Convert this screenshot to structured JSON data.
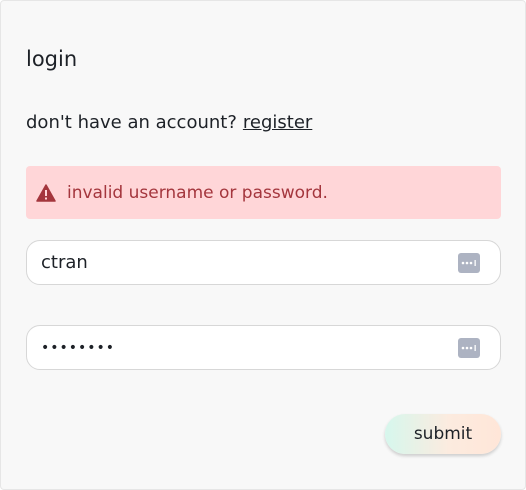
{
  "form": {
    "title": "login",
    "register_prompt": "don't have an account?",
    "register_link": "register"
  },
  "alert": {
    "message": "invalid username or password.",
    "icon": "warning-triangle-icon",
    "color": "#a4363d",
    "background": "#ffd6d8"
  },
  "fields": {
    "username": {
      "value": "ctran",
      "icon": "password-manager-icon"
    },
    "password": {
      "value": "••••••••",
      "icon": "password-manager-icon"
    }
  },
  "submit": {
    "label": "submit"
  }
}
